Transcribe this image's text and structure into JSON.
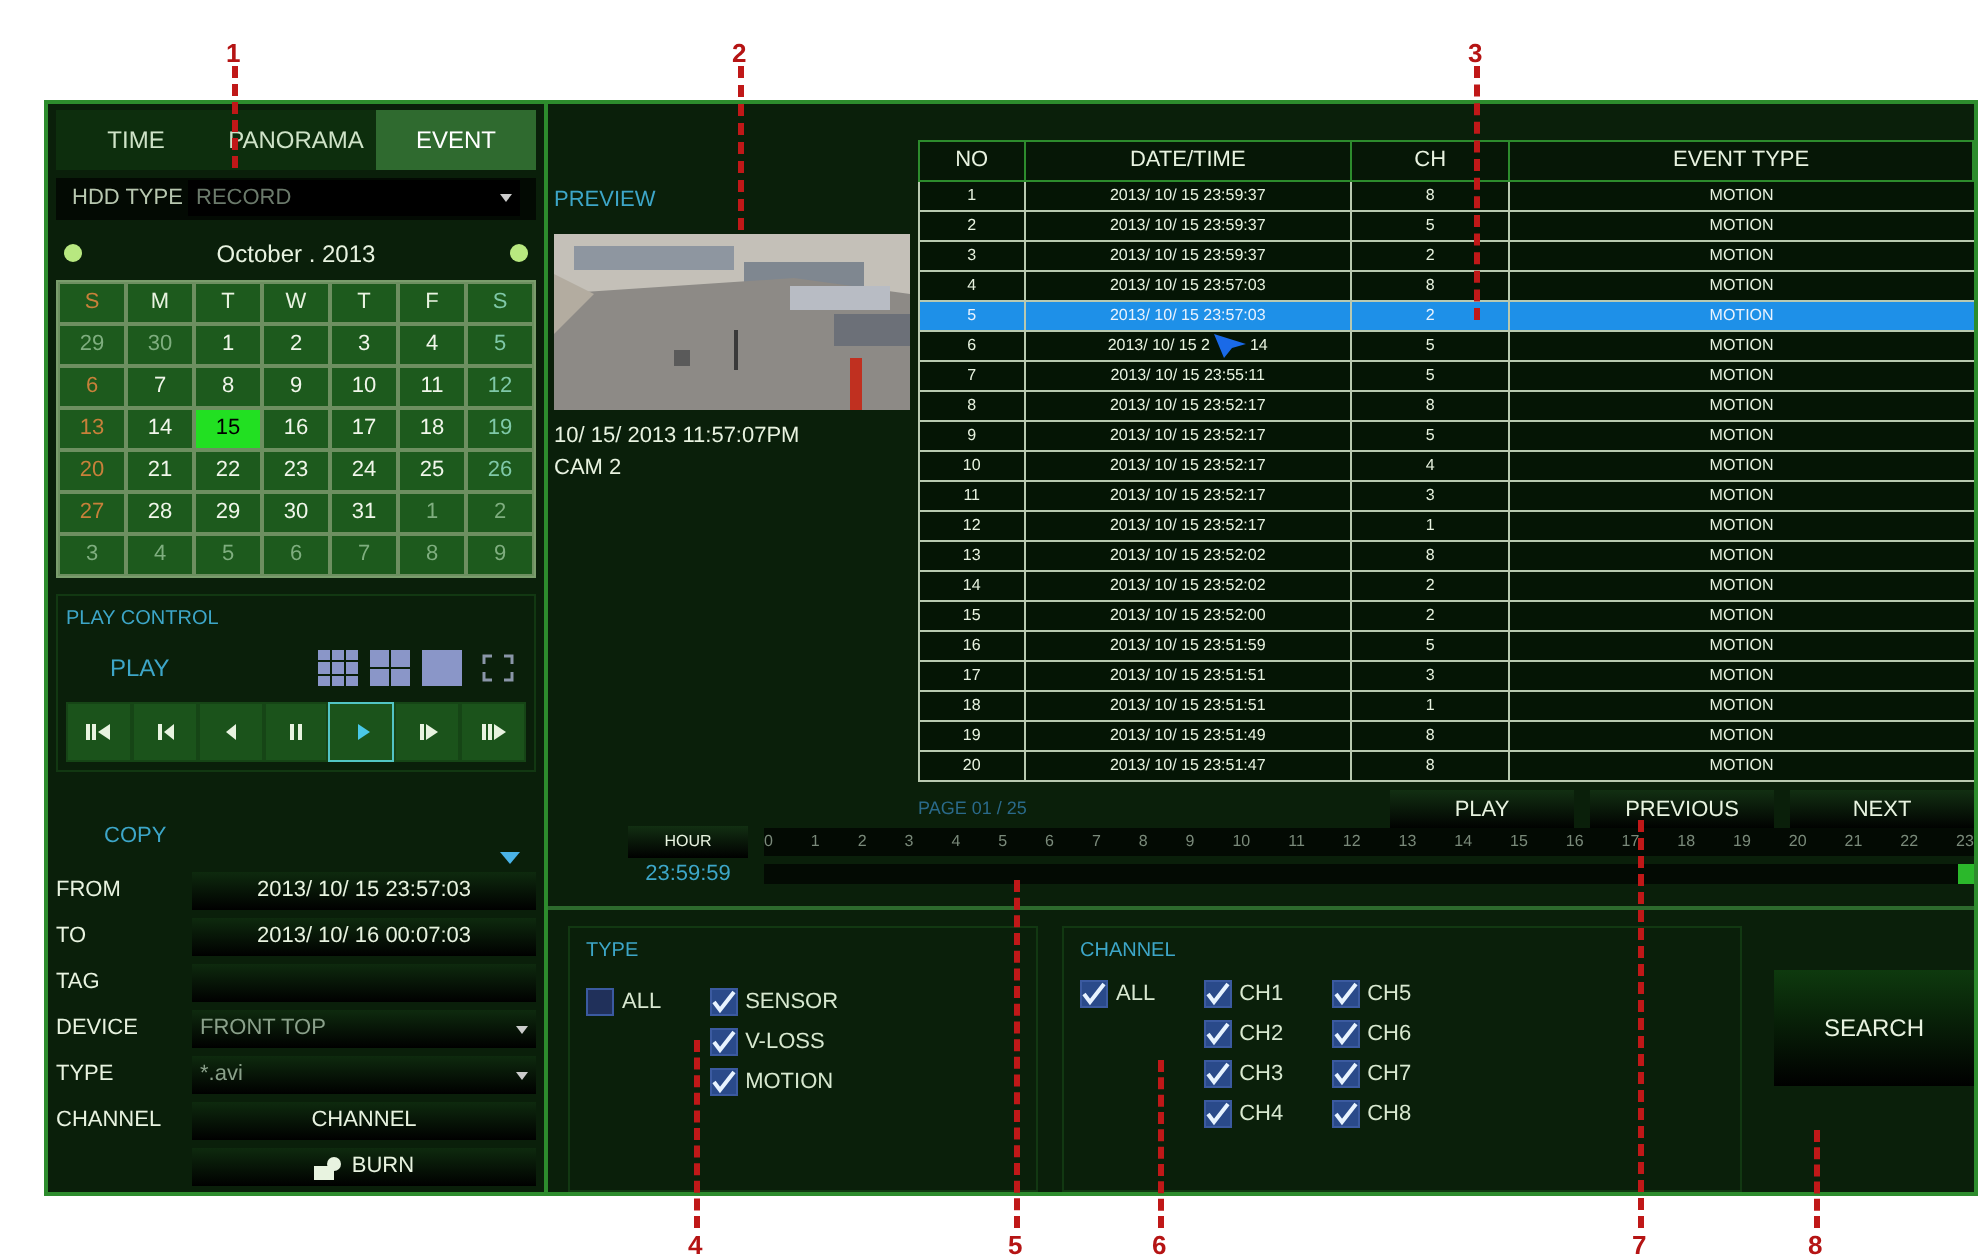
{
  "tabs": [
    {
      "label": "TIME",
      "selected": false
    },
    {
      "label": "PANORAMA",
      "selected": false
    },
    {
      "label": "EVENT",
      "selected": true
    }
  ],
  "hdd_type": {
    "label": "HDD TYPE",
    "value": "RECORD"
  },
  "calendar": {
    "title": "October . 2013",
    "weekdays": [
      "S",
      "M",
      "T",
      "W",
      "T",
      "F",
      "S"
    ],
    "weeks": [
      [
        {
          "day": "29",
          "dim": true,
          "selected": false
        },
        {
          "day": "30",
          "dim": true,
          "selected": false
        },
        {
          "day": "1",
          "dim": false,
          "selected": false
        },
        {
          "day": "2",
          "dim": false,
          "selected": false
        },
        {
          "day": "3",
          "dim": false,
          "selected": false
        },
        {
          "day": "4",
          "dim": false,
          "selected": false
        },
        {
          "day": "5",
          "dim": false,
          "selected": false
        }
      ],
      [
        {
          "day": "6",
          "dim": false,
          "selected": false
        },
        {
          "day": "7",
          "dim": false,
          "selected": false
        },
        {
          "day": "8",
          "dim": false,
          "selected": false
        },
        {
          "day": "9",
          "dim": false,
          "selected": false
        },
        {
          "day": "10",
          "dim": false,
          "selected": false
        },
        {
          "day": "11",
          "dim": false,
          "selected": false
        },
        {
          "day": "12",
          "dim": false,
          "selected": false
        }
      ],
      [
        {
          "day": "13",
          "dim": false,
          "selected": false
        },
        {
          "day": "14",
          "dim": false,
          "selected": false
        },
        {
          "day": "15",
          "dim": false,
          "selected": true
        },
        {
          "day": "16",
          "dim": false,
          "selected": false
        },
        {
          "day": "17",
          "dim": false,
          "selected": false
        },
        {
          "day": "18",
          "dim": false,
          "selected": false
        },
        {
          "day": "19",
          "dim": false,
          "selected": false
        }
      ],
      [
        {
          "day": "20",
          "dim": false,
          "selected": false
        },
        {
          "day": "21",
          "dim": false,
          "selected": false
        },
        {
          "day": "22",
          "dim": false,
          "selected": false
        },
        {
          "day": "23",
          "dim": false,
          "selected": false
        },
        {
          "day": "24",
          "dim": false,
          "selected": false
        },
        {
          "day": "25",
          "dim": false,
          "selected": false
        },
        {
          "day": "26",
          "dim": false,
          "selected": false
        }
      ],
      [
        {
          "day": "27",
          "dim": false,
          "selected": false
        },
        {
          "day": "28",
          "dim": false,
          "selected": false
        },
        {
          "day": "29",
          "dim": false,
          "selected": false
        },
        {
          "day": "30",
          "dim": false,
          "selected": false
        },
        {
          "day": "31",
          "dim": false,
          "selected": false
        },
        {
          "day": "1",
          "dim": true,
          "selected": false
        },
        {
          "day": "2",
          "dim": true,
          "selected": false
        }
      ],
      [
        {
          "day": "3",
          "dim": true,
          "selected": false
        },
        {
          "day": "4",
          "dim": true,
          "selected": false
        },
        {
          "day": "5",
          "dim": true,
          "selected": false
        },
        {
          "day": "6",
          "dim": true,
          "selected": false
        },
        {
          "day": "7",
          "dim": true,
          "selected": false
        },
        {
          "day": "8",
          "dim": true,
          "selected": false
        },
        {
          "day": "9",
          "dim": true,
          "selected": false
        }
      ]
    ]
  },
  "play_control": {
    "title": "PLAY CONTROL",
    "label": "PLAY",
    "buttons": [
      {
        "kind": "fast-rewind",
        "selected": false
      },
      {
        "kind": "step-back",
        "selected": false
      },
      {
        "kind": "rewind",
        "selected": false
      },
      {
        "kind": "pause",
        "selected": false
      },
      {
        "kind": "play",
        "selected": true
      },
      {
        "kind": "step-forward",
        "selected": false
      },
      {
        "kind": "fast-forward",
        "selected": false
      }
    ]
  },
  "copy": {
    "title": "COPY",
    "fields": [
      {
        "label": "FROM",
        "kind": "text",
        "value": "2013/ 10/ 15 23:57:03"
      },
      {
        "label": "TO",
        "kind": "text",
        "value": "2013/ 10/ 16 00:07:03"
      },
      {
        "label": "TAG",
        "kind": "text"
      },
      {
        "label": "DEVICE",
        "kind": "select",
        "value": "FRONT TOP"
      },
      {
        "label": "TYPE",
        "kind": "select",
        "value": "*.avi"
      },
      {
        "label": "CHANNEL",
        "kind": "button",
        "value": "CHANNEL"
      }
    ],
    "burn": "BURN"
  },
  "preview": {
    "title": "PREVIEW",
    "timestamp": "10/ 15/ 2013 11:57:07PM",
    "camera": "CAM 2"
  },
  "event_table": {
    "columns": [
      "NO",
      "DATE/TIME",
      "CH",
      "EVENT TYPE"
    ],
    "rows": [
      {
        "no": "1",
        "datetime": "2013/ 10/ 15 23:59:37",
        "ch": "8",
        "type": "MOTION",
        "selected": false
      },
      {
        "no": "2",
        "datetime": "2013/ 10/ 15 23:59:37",
        "ch": "5",
        "type": "MOTION",
        "selected": false
      },
      {
        "no": "3",
        "datetime": "2013/ 10/ 15 23:59:37",
        "ch": "2",
        "type": "MOTION",
        "selected": false
      },
      {
        "no": "4",
        "datetime": "2013/ 10/ 15 23:57:03",
        "ch": "8",
        "type": "MOTION",
        "selected": false
      },
      {
        "no": "5",
        "datetime": "2013/ 10/ 15 23:57:03",
        "ch": "2",
        "type": "MOTION",
        "selected": true
      },
      {
        "no": "6",
        "datetime": "2013/ 10/ 15 2",
        "datetime_after_cursor": "14",
        "ch": "5",
        "type": "MOTION",
        "selected": false
      },
      {
        "no": "7",
        "datetime": "2013/ 10/ 15 23:55:11",
        "ch": "5",
        "type": "MOTION",
        "selected": false
      },
      {
        "no": "8",
        "datetime": "2013/ 10/ 15 23:52:17",
        "ch": "8",
        "type": "MOTION",
        "selected": false
      },
      {
        "no": "9",
        "datetime": "2013/ 10/ 15 23:52:17",
        "ch": "5",
        "type": "MOTION",
        "selected": false
      },
      {
        "no": "10",
        "datetime": "2013/ 10/ 15 23:52:17",
        "ch": "4",
        "type": "MOTION",
        "selected": false
      },
      {
        "no": "11",
        "datetime": "2013/ 10/ 15 23:52:17",
        "ch": "3",
        "type": "MOTION",
        "selected": false
      },
      {
        "no": "12",
        "datetime": "2013/ 10/ 15 23:52:17",
        "ch": "1",
        "type": "MOTION",
        "selected": false
      },
      {
        "no": "13",
        "datetime": "2013/ 10/ 15 23:52:02",
        "ch": "8",
        "type": "MOTION",
        "selected": false
      },
      {
        "no": "14",
        "datetime": "2013/ 10/ 15 23:52:02",
        "ch": "2",
        "type": "MOTION",
        "selected": false
      },
      {
        "no": "15",
        "datetime": "2013/ 10/ 15 23:52:00",
        "ch": "2",
        "type": "MOTION",
        "selected": false
      },
      {
        "no": "16",
        "datetime": "2013/ 10/ 15 23:51:59",
        "ch": "5",
        "type": "MOTION",
        "selected": false
      },
      {
        "no": "17",
        "datetime": "2013/ 10/ 15 23:51:51",
        "ch": "3",
        "type": "MOTION",
        "selected": false
      },
      {
        "no": "18",
        "datetime": "2013/ 10/ 15 23:51:51",
        "ch": "1",
        "type": "MOTION",
        "selected": false
      },
      {
        "no": "19",
        "datetime": "2013/ 10/ 15 23:51:49",
        "ch": "8",
        "type": "MOTION",
        "selected": false
      },
      {
        "no": "20",
        "datetime": "2013/ 10/ 15 23:51:47",
        "ch": "8",
        "type": "MOTION",
        "selected": false
      }
    ]
  },
  "pager": {
    "page": "PAGE 01 / 25",
    "buttons": [
      "PLAY",
      "PREVIOUS",
      "NEXT"
    ]
  },
  "timeline": {
    "button": "HOUR",
    "time": "23:59:59",
    "hours": [
      "0",
      "1",
      "2",
      "3",
      "4",
      "5",
      "6",
      "7",
      "8",
      "9",
      "10",
      "11",
      "12",
      "13",
      "14",
      "15",
      "16",
      "17",
      "18",
      "19",
      "20",
      "21",
      "22",
      "23"
    ],
    "level": 1
  },
  "search": {
    "type": {
      "title": "TYPE",
      "all": {
        "label": "ALL",
        "checked": false
      },
      "items": [
        {
          "label": "SENSOR",
          "checked": true
        },
        {
          "label": "V-LOSS",
          "checked": true
        },
        {
          "label": "MOTION",
          "checked": true
        }
      ]
    },
    "channel": {
      "title": "CHANNEL",
      "all": {
        "label": "ALL",
        "checked": true
      },
      "items": [
        {
          "label": "CH1",
          "checked": true
        },
        {
          "label": "CH2",
          "checked": true
        },
        {
          "label": "CH3",
          "checked": true
        },
        {
          "label": "CH4",
          "checked": true
        },
        {
          "label": "CH5",
          "checked": true
        },
        {
          "label": "CH6",
          "checked": true
        },
        {
          "label": "CH7",
          "checked": true
        },
        {
          "label": "CH8",
          "checked": true
        }
      ]
    },
    "button": "SEARCH"
  },
  "callouts": [
    "1",
    "2",
    "3",
    "4",
    "5",
    "6",
    "7",
    "8"
  ]
}
